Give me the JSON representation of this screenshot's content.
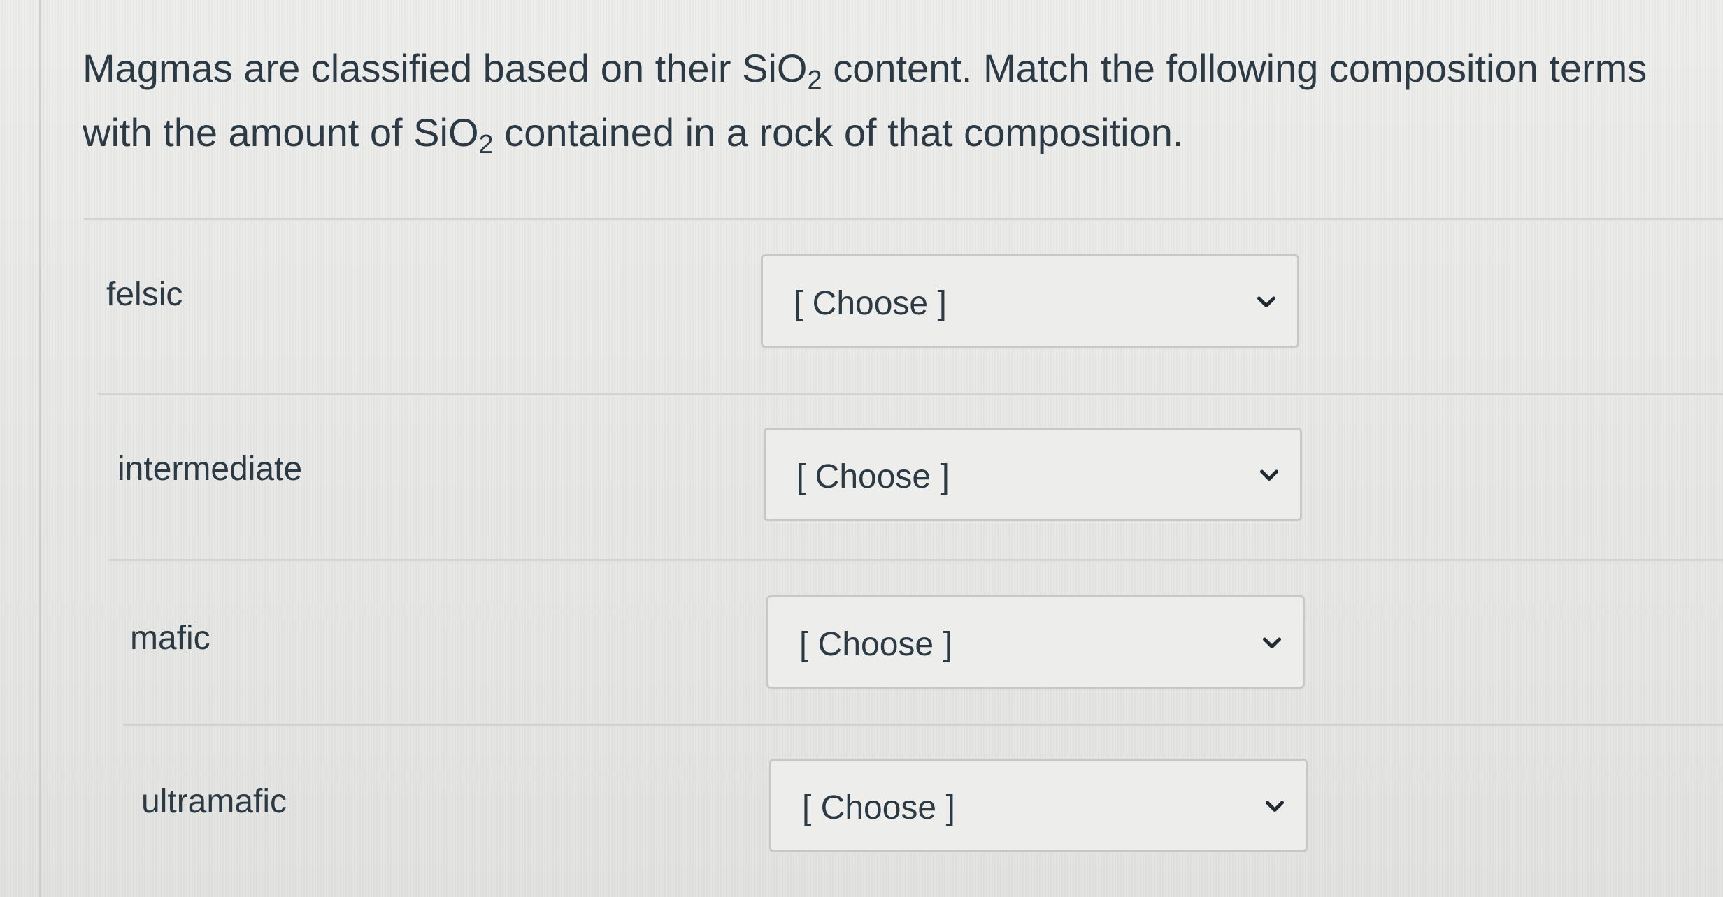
{
  "question": {
    "part1": "Magmas are classified based on their SiO",
    "sub1": "2",
    "part2": " content. Match the following composition terms with the amount of SiO",
    "sub2": "2",
    "part3": " contained in a rock of that composition."
  },
  "rows": [
    {
      "term": "felsic",
      "select_value": "[ Choose ]"
    },
    {
      "term": "intermediate",
      "select_value": "[ Choose ]"
    },
    {
      "term": "mafic",
      "select_value": "[ Choose ]"
    },
    {
      "term": "ultramafic",
      "select_value": "[ Choose ]"
    }
  ],
  "icons": {
    "dropdown": "chevron-down-icon"
  },
  "colors": {
    "text": "#2b3a44",
    "background": "#e6e6e4",
    "border": "#c8c8c6"
  }
}
